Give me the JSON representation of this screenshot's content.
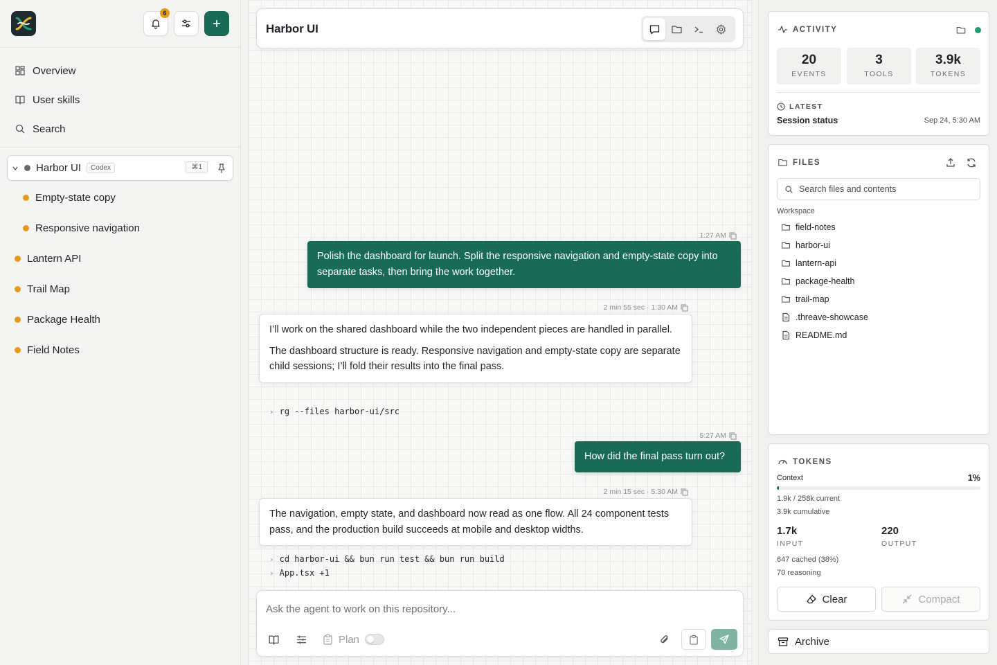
{
  "sidebar": {
    "notification_count": "6",
    "nav": [
      {
        "label": "Overview",
        "icon": "grid-icon"
      },
      {
        "label": "User skills",
        "icon": "book-icon"
      },
      {
        "label": "Search",
        "icon": "search-icon"
      }
    ],
    "project": {
      "name": "Harbor UI",
      "tag": "Codex",
      "shortcut": "⌘1"
    },
    "child_sessions": [
      "Empty-state copy",
      "Responsive navigation"
    ],
    "sessions": [
      "Lantern API",
      "Trail Map",
      "Package Health",
      "Field Notes"
    ],
    "colors": {
      "accent": "#176b57",
      "session_dot": "#e79b11"
    }
  },
  "chat": {
    "title": "Harbor UI",
    "messages": [
      {
        "meta": "1:27 AM",
        "text": "Polish the dashboard for launch. Split the responsive navigation and empty-state copy into separate tasks, then bring the work together."
      },
      {
        "meta": "2 min 55 sec · 1:30 AM",
        "p1": "I’ll work on the shared dashboard while the two independent pieces are handled in parallel.",
        "p2": "The dashboard structure is ready. Responsive navigation and empty-state copy are separate child sessions; I’ll fold their results into the final pass.",
        "cmd": "rg --files harbor-ui/src"
      },
      {
        "meta": "5:27 AM",
        "text": "How did the final pass turn out?"
      },
      {
        "meta": "2 min 15 sec · 5:30 AM",
        "p1": "The navigation, empty state, and dashboard now read as one flow. All 24 component tests pass, and the production build succeeds at mobile and desktop widths.",
        "cmd1": "cd harbor-ui && bun run test && bun run build",
        "cmd2": "App.tsx +1"
      }
    ],
    "composer": {
      "placeholder": "Ask the agent to work on this repository...",
      "plan_label": "Plan"
    }
  },
  "activity": {
    "title": "ACTIVITY",
    "stats": [
      {
        "value": "20",
        "label": "EVENTS"
      },
      {
        "value": "3",
        "label": "TOOLS"
      },
      {
        "value": "3.9k",
        "label": "TOKENS"
      }
    ],
    "latest_label": "LATEST",
    "latest_item": "Session status",
    "latest_time": "Sep 24, 5:30 AM"
  },
  "files": {
    "title": "FILES",
    "search_placeholder": "Search files and contents",
    "section": "Workspace",
    "folders": [
      "field-notes",
      "harbor-ui",
      "lantern-api",
      "package-health",
      "trail-map"
    ],
    "docs": [
      ".threave-showcase",
      "README.md"
    ]
  },
  "tokens": {
    "title": "TOKENS",
    "context_label": "Context",
    "context_pct": "1%",
    "context_fraction": 0.01,
    "current": "1.9k / 258k current",
    "cumulative": "3.9k cumulative",
    "input_value": "1.7k",
    "input_label": "INPUT",
    "output_value": "220",
    "output_label": "OUTPUT",
    "cached": "647 cached (38%)",
    "reasoning": "70 reasoning",
    "clear_label": "Clear",
    "compact_label": "Compact"
  },
  "archive_label": "Archive"
}
